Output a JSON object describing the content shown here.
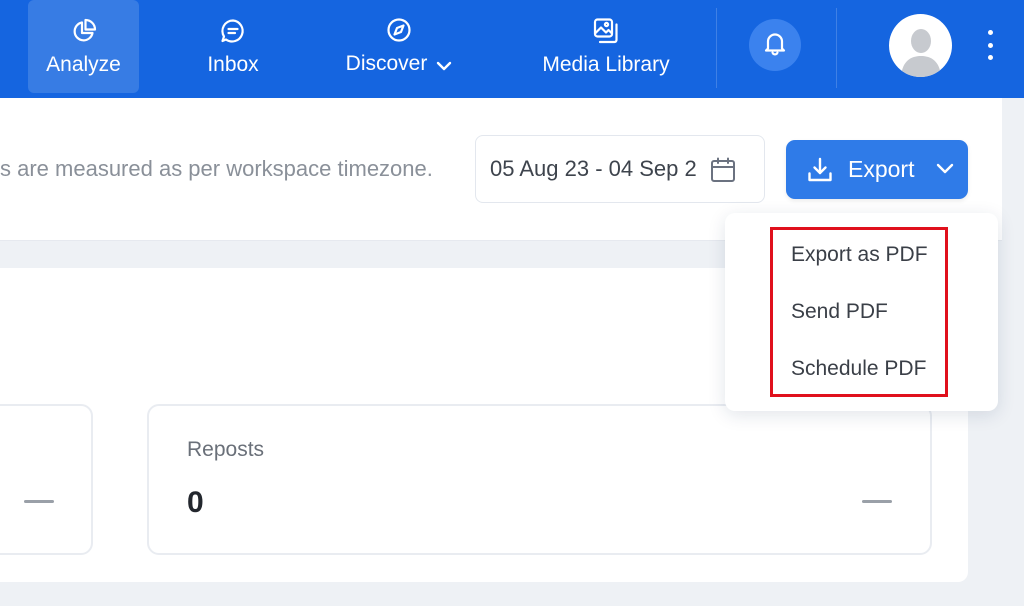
{
  "nav": {
    "items": [
      {
        "label": "Analyze",
        "icon": "pie-chart-icon",
        "active": true
      },
      {
        "label": "Inbox",
        "icon": "chat-bubble-icon"
      },
      {
        "label": "Discover",
        "icon": "compass-icon",
        "has_dropdown": true
      },
      {
        "label": "Media Library",
        "icon": "image-gallery-icon"
      }
    ]
  },
  "header": {
    "timezone_note": "s are measured as per workspace timezone.",
    "date_range": "05 Aug 23 - 04 Sep 2",
    "export_label": "Export"
  },
  "export_menu": {
    "items": [
      {
        "label": "Export as PDF"
      },
      {
        "label": "Send PDF"
      },
      {
        "label": "Schedule PDF"
      }
    ]
  },
  "cards": {
    "reposts": {
      "label": "Reposts",
      "value": "0"
    }
  },
  "colors": {
    "nav_bg": "#1565e0",
    "accent": "#2f7be8",
    "highlight": "#e0101c"
  }
}
